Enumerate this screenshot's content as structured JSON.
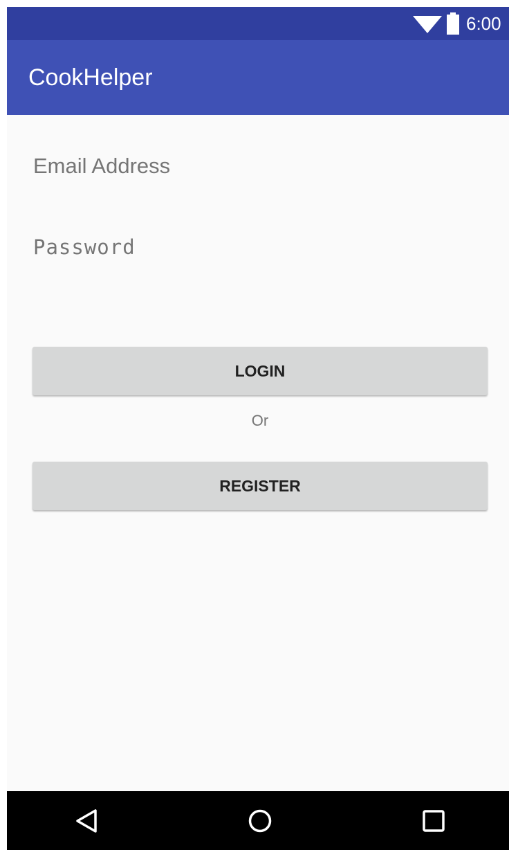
{
  "status_bar": {
    "time": "6:00",
    "background": "#303f9f",
    "icons": [
      "wifi-icon",
      "battery-icon"
    ]
  },
  "app_bar": {
    "title": "CookHelper",
    "background": "#3f51b5"
  },
  "form": {
    "email": {
      "value": "",
      "placeholder": "Email Address"
    },
    "password": {
      "value": "",
      "placeholder": "Password"
    },
    "login_label": "LOGIN",
    "or_label": "Or",
    "register_label": "REGISTER",
    "button_color": "#d6d7d7"
  },
  "nav_bar": {
    "icons": [
      "back-icon",
      "home-icon",
      "recents-icon"
    ]
  }
}
